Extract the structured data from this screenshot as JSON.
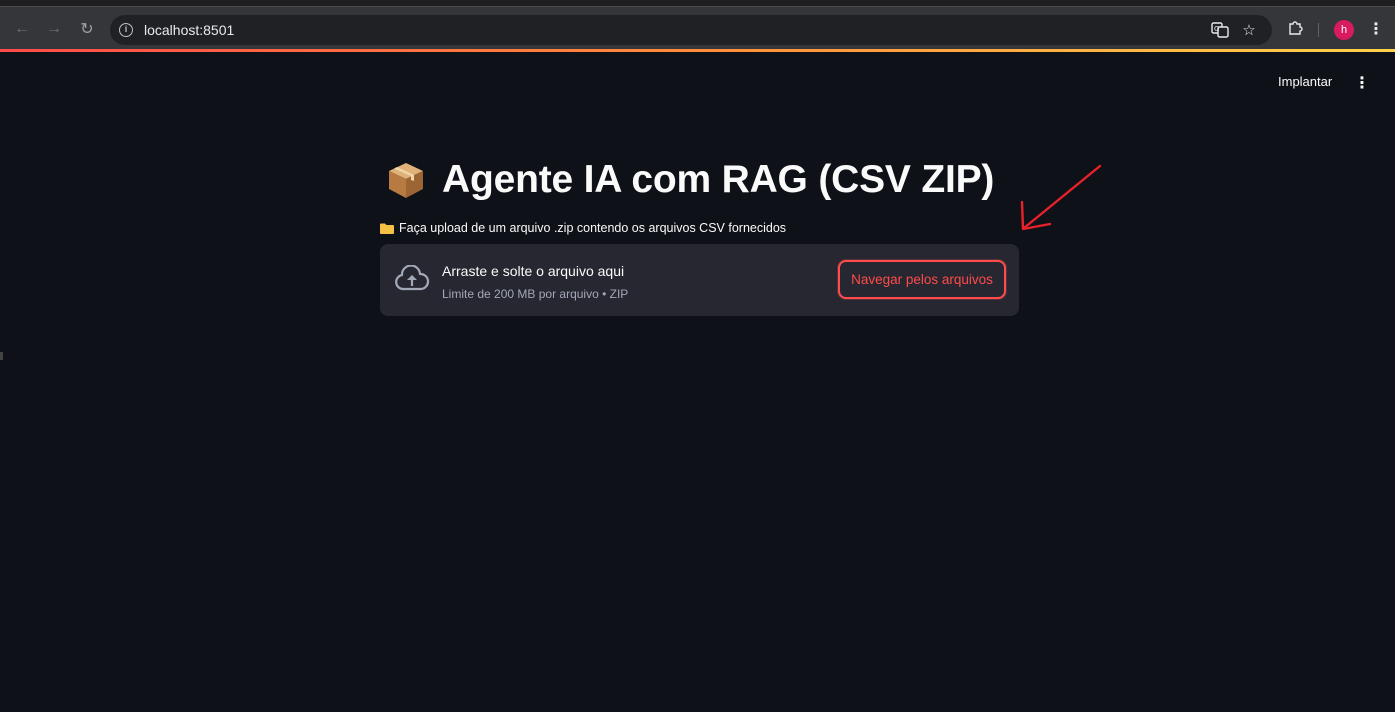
{
  "browser": {
    "url": "localhost:8501",
    "profile_initial": "h",
    "icons": [
      "back-arrow-icon",
      "forward-arrow-icon",
      "reload-icon",
      "site-info-icon",
      "translate-icon",
      "bookmark-star-icon",
      "extensions-icon",
      "profile-avatar",
      "kebab-menu-icon"
    ]
  },
  "app": {
    "deploy_label": "Implantar",
    "title": "Agente IA com RAG (CSV ZIP)",
    "caption": "Faça upload de um arquivo .zip contendo os arquivos CSV fornecidos",
    "uploader": {
      "drop_text": "Arraste e solte o arquivo aqui",
      "limit_text": "Limite de 200 MB por arquivo • ZIP",
      "browse_label": "Navegar pelos arquivos"
    }
  },
  "colors": {
    "background": "#0e1117",
    "accent": "#ff4b4b",
    "uploader_bg": "#262730",
    "annotation_arrow": "#e8212b"
  }
}
